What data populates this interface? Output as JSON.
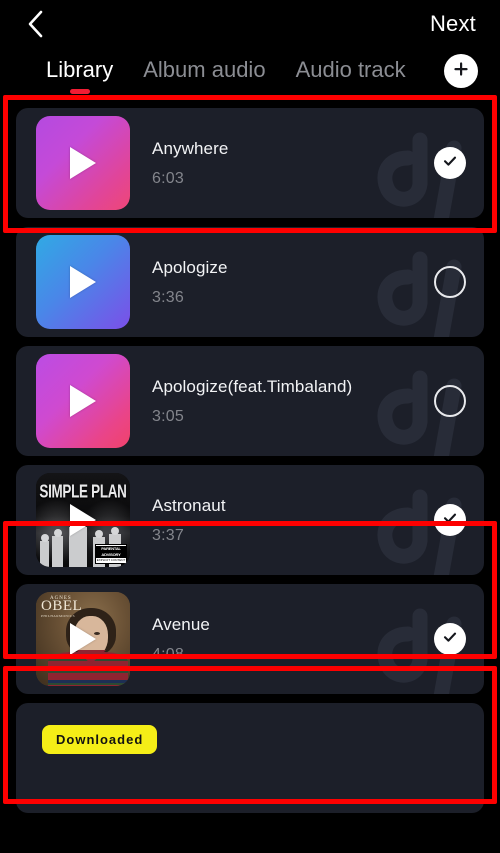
{
  "header": {
    "back_icon": "chevron-left-icon",
    "next_label": "Next"
  },
  "tabs": {
    "items": [
      {
        "label": "Library",
        "active": true
      },
      {
        "label": "Album audio",
        "active": false
      },
      {
        "label": "Audio track",
        "active": false
      }
    ],
    "add_icon": "plus-icon",
    "active_indicator_color": "#f11d34"
  },
  "tracks": [
    {
      "title": "Anywhere",
      "duration": "6:03",
      "selected": true,
      "art": "gradient-purple-pink",
      "highlighted": true
    },
    {
      "title": "Apologize",
      "duration": "3:36",
      "selected": false,
      "art": "gradient-blue-purple",
      "highlighted": false
    },
    {
      "title": "Apologize(feat.Timbaland)",
      "duration": "3:05",
      "selected": false,
      "art": "gradient-purple-pink",
      "highlighted": false
    },
    {
      "title": "Astronaut",
      "duration": "3:37",
      "selected": true,
      "art": "album-simple-plan",
      "highlighted": true
    },
    {
      "title": "Avenue",
      "duration": "4:08",
      "selected": true,
      "art": "album-agnes-obel",
      "highlighted": true
    }
  ],
  "album_art": {
    "simple_plan": {
      "band_name": "SIMPLE PLAN",
      "advisory_line1": "PARENTAL",
      "advisory_line2": "ADVISORY",
      "advisory_line3": "EXPLICIT CONTENT"
    },
    "agnes_obel": {
      "artist_top": "AGNES",
      "artist_main": "OBEL",
      "album": "PHILHARMONICS"
    }
  },
  "bottom_card": {
    "badge_label": "Downloaded"
  },
  "colors": {
    "page_background": "#000000",
    "card_background": "#1c1f29",
    "accent_red": "#f11d34",
    "annotation_red": "#fe0000",
    "title_text": "#f2f3f5",
    "duration_text": "#83858c",
    "inactive_tab": "#8b8d93",
    "badge_yellow": "#f5ee17"
  }
}
